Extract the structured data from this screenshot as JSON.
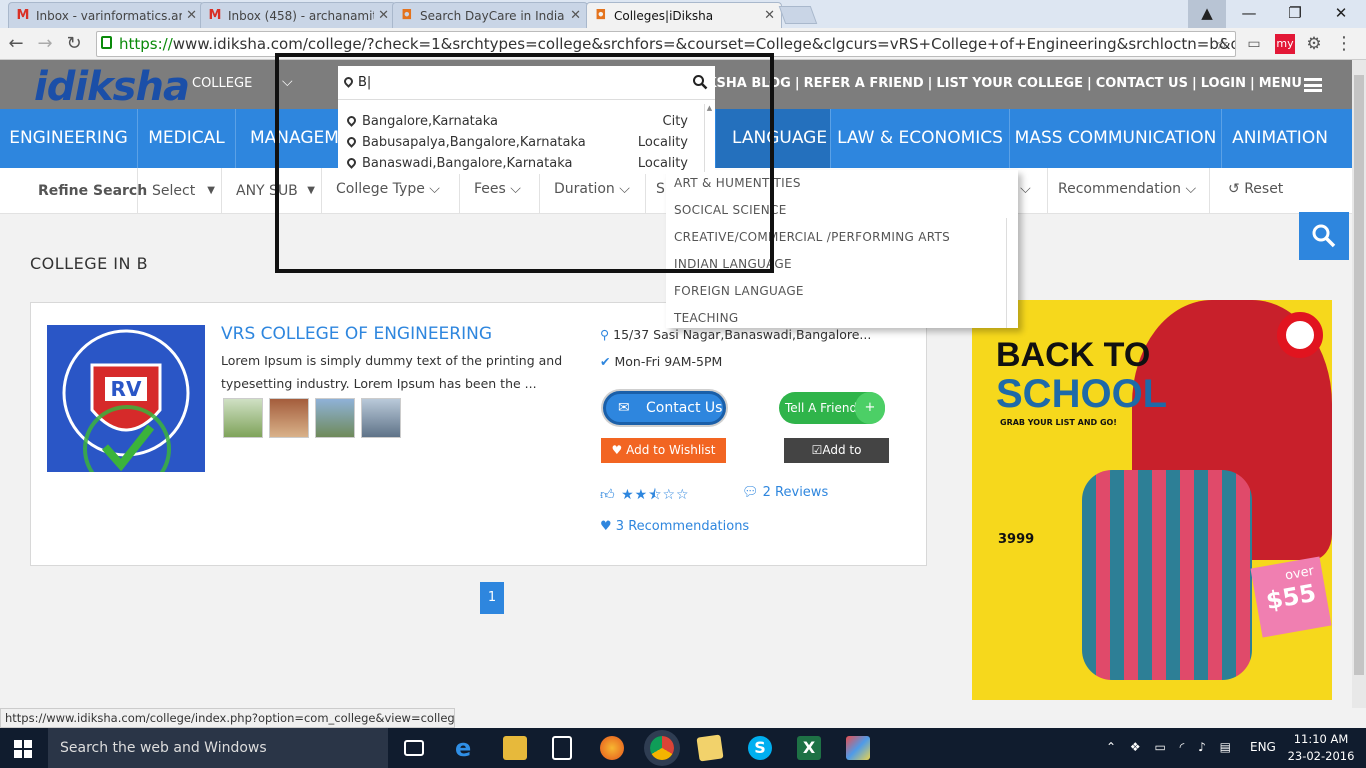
{
  "browser": {
    "tabs": [
      {
        "icon": "gmail-icon",
        "title": "Inbox - varinformatics.arch"
      },
      {
        "icon": "gmail-icon",
        "title": "Inbox (458) - archanamithr"
      },
      {
        "icon": "idiksha-icon",
        "title": "Search DayCare in India|iD"
      },
      {
        "icon": "idiksha-icon",
        "title": "Colleges|iDiksha"
      }
    ],
    "url_scheme": "https://",
    "url_rest": "www.idiksha.com/college/?check=1&srchtypes=college&srchfors=&courset=College&clgcurs=vRS+College+of+Engineering&srchloctn=b&option"
  },
  "header": {
    "logo_text": "idiksha",
    "college_label": "COLLEGE",
    "nav": [
      "IDIKSHA BLOG",
      "REFER A FRIEND",
      "LIST YOUR COLLEGE",
      "CONTACT US",
      "LOGIN",
      "MENU"
    ]
  },
  "categories": [
    "ENGINEERING",
    "MEDICAL",
    "MANAGEMENT",
    "LANGUAGE",
    "LAW & ECONOMICS",
    "MASS COMMUNICATION",
    "ANIMATION"
  ],
  "filters": {
    "refine": "Refine Search",
    "select": "Select",
    "any_sub": "ANY SUB",
    "college_type": "College Type",
    "fees": "Fees",
    "duration": "Duration",
    "s": "S",
    "rating": "ating",
    "recommendation": "Recommendation",
    "reset": "Reset"
  },
  "location_search": {
    "value": "B",
    "suggestions": [
      {
        "name": "Bangalore,Karnataka",
        "type": "City"
      },
      {
        "name": "Babusapalya,Bangalore,Karnataka",
        "type": "Locality"
      },
      {
        "name": "Banaswadi,Bangalore,Karnataka",
        "type": "Locality"
      }
    ]
  },
  "subject_dropdown": [
    "ART & HUMENTITIES",
    "SOCICAL SCIENCE",
    "CREATIVE/COMMERCIAL /PERFORMING ARTS",
    "INDIAN LANGUAGE",
    "FOREIGN LANGUAGE",
    "TEACHING"
  ],
  "results": {
    "heading": "COLLEGE IN B",
    "college": {
      "name": "VRS COLLEGE OF ENGINEERING",
      "description": "Lorem Ipsum is simply dummy text of the printing and typesetting industry. Lorem Ipsum has been the ...",
      "address": "15/37 Sasi Nagar,Banaswadi,Bangalore...",
      "hours": "Mon-Fri 9AM-5PM",
      "contact_label": "Contact Us",
      "tell_label": "Tell A Friend",
      "wishlist_label": "Add to Wishlist",
      "compare_label": "Add to Compare",
      "rating": 2.5,
      "reviews": "2 Reviews",
      "recommendations": "3 Recommendations",
      "logo_text": "RV"
    },
    "page": "1"
  },
  "ad": {
    "headline1": "BACK TO",
    "headline2": "SCHOOL",
    "subline": "GRAB YOUR LIST AND GO!",
    "price": "3999",
    "over": "over",
    "amount": "$55"
  },
  "status_url": "https://www.idiksha.com/college/index.php?option=com_college&view=colleges&...",
  "taskbar": {
    "search_placeholder": "Search the web and Windows",
    "lang": "ENG",
    "time": "11:10 AM",
    "date": "23-02-2016"
  }
}
